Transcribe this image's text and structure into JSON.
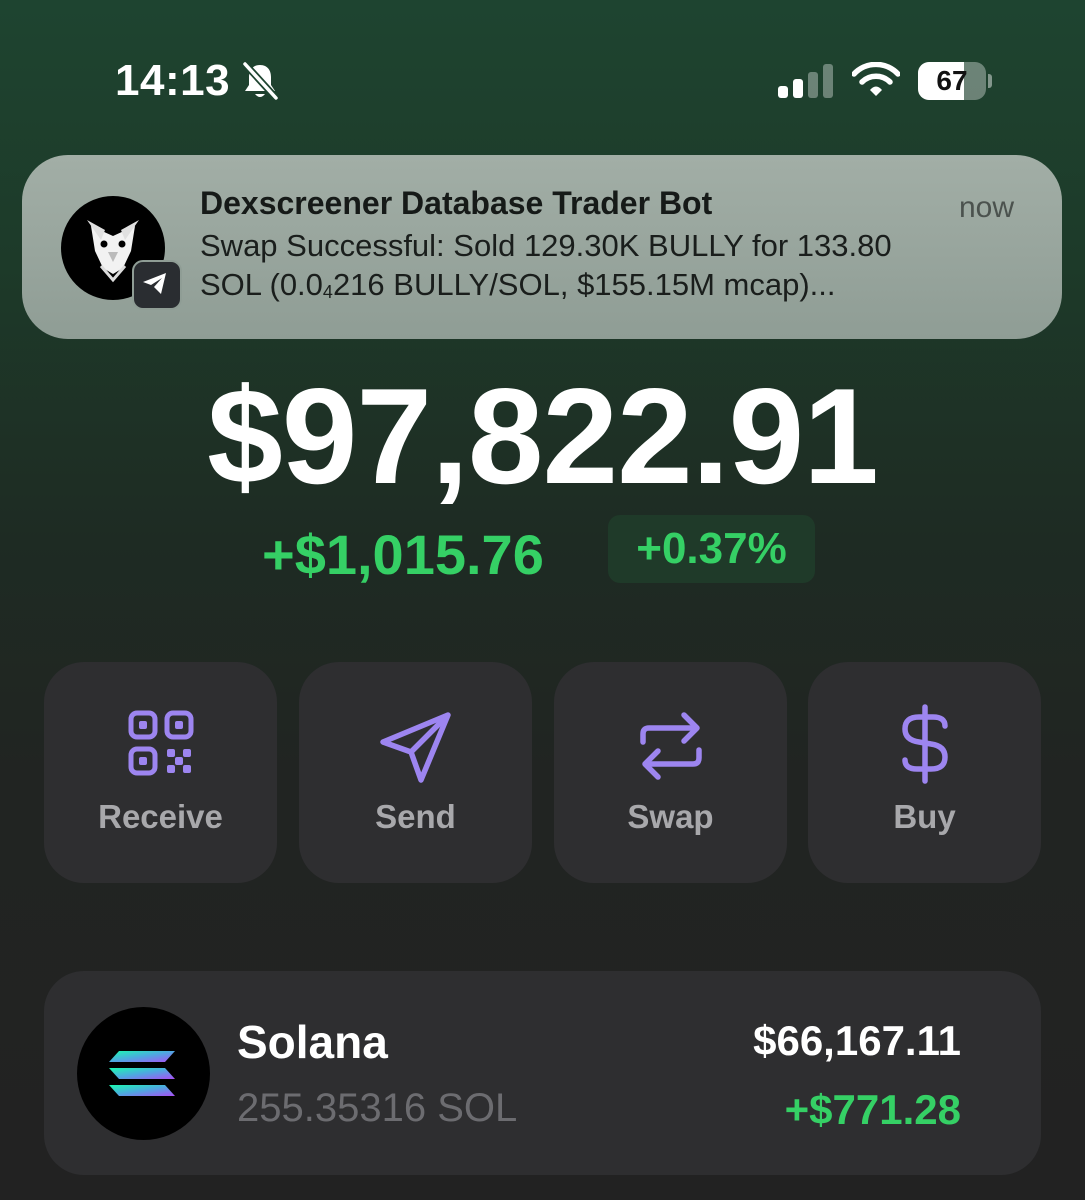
{
  "status_bar": {
    "time": "14:13",
    "battery": "67",
    "battery_level": 0.67,
    "icons": [
      "bell-slash-icon",
      "cellular-signal-icon",
      "wifi-icon",
      "battery-icon"
    ]
  },
  "notification": {
    "app": "Telegram",
    "title": "Dexscreener Database Trader Bot",
    "time": "now",
    "line1": "Swap Successful: Sold 129.30K BULLY for 133.80",
    "line2_a": "SOL (0.0",
    "line2_sub": "4",
    "line2_b": "216 BULLY/SOL, $155.15M mcap)..."
  },
  "portfolio": {
    "balance": "$97,822.91",
    "change_amount": "+$1,015.76",
    "change_percent": "+0.37%"
  },
  "actions": [
    {
      "label": "Receive",
      "icon": "qr-code-icon"
    },
    {
      "label": "Send",
      "icon": "paper-plane-icon"
    },
    {
      "label": "Swap",
      "icon": "swap-arrows-icon"
    },
    {
      "label": "Buy",
      "icon": "dollar-icon"
    }
  ],
  "tokens": [
    {
      "name": "Solana",
      "quantity": "255.35316 SOL",
      "value": "$66,167.11",
      "change": "+$771.28"
    }
  ],
  "colors": {
    "positive": "#35d065",
    "accent": "#9d85f0",
    "card": "#2e2e30"
  }
}
